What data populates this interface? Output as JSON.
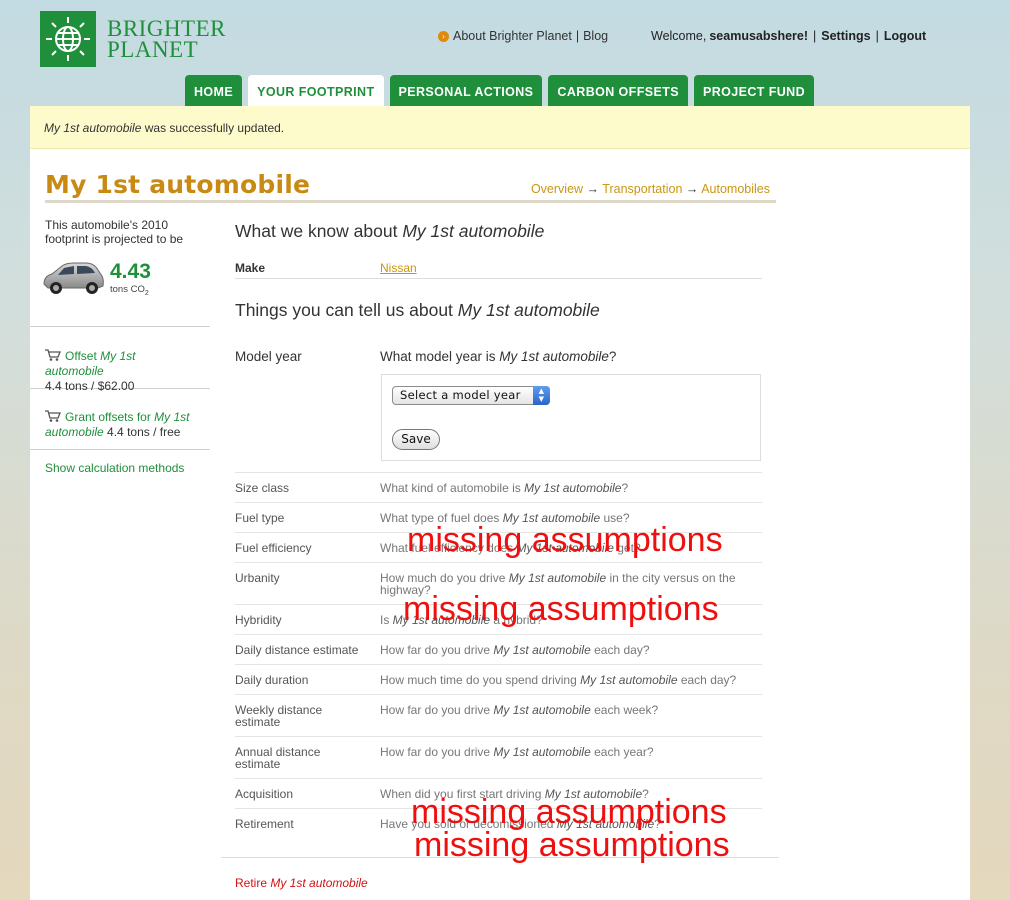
{
  "brand": {
    "line1": "BRIGHTER",
    "line2": "PLANET"
  },
  "topnav": {
    "about": "About Brighter Planet",
    "sep": "|",
    "blog": "Blog"
  },
  "userbar": {
    "welcome": "Welcome,",
    "username": "seamusabshere!",
    "sep": "|",
    "settings": "Settings",
    "logout": "Logout"
  },
  "tabs": [
    "HOME",
    "YOUR FOOTPRINT",
    "PERSONAL ACTIONS",
    "CARBON OFFSETS",
    "PROJECT FUND"
  ],
  "active_tab": "YOUR FOOTPRINT",
  "flash": {
    "name": "My 1st automobile",
    "text": " was successfully updated."
  },
  "page": {
    "title": "My 1st automobile"
  },
  "breadcrumb": {
    "overview": "Overview",
    "arrow": "→",
    "transportation": "Transportation",
    "automobiles": "Automobiles"
  },
  "sidebar": {
    "projection_text": "This automobile's 2010 footprint is projected to be",
    "value": "4.43",
    "unit": "tons CO",
    "unit_sub": "2",
    "offset_prefix": "Offset ",
    "offset_name": "My 1st automobile",
    "offset_detail": "4.4 tons / $62.00",
    "grant_prefix": "Grant offsets for ",
    "grant_name": "My 1st automobile",
    "grant_detail": " 4.4 tons / free",
    "calc_link": "Show calculation methods"
  },
  "known": {
    "heading_prefix": "What we know about ",
    "heading_name": "My 1st automobile",
    "make_label": "Make",
    "make_value": "Nissan"
  },
  "tell": {
    "heading_prefix": "Things you can tell us about ",
    "heading_name": "My 1st automobile"
  },
  "model_year": {
    "label": "Model year",
    "question_prefix": "What model year is ",
    "question_name": "My 1st automobile",
    "question_suffix": "?",
    "select_value": "Select a model year",
    "save_label": "Save"
  },
  "questions": [
    {
      "label": "Size class",
      "pre": "What kind of automobile is ",
      "name": "My 1st automobile",
      "post": "?"
    },
    {
      "label": "Fuel type",
      "pre": "What type of fuel does ",
      "name": "My 1st automobile",
      "post": " use?"
    },
    {
      "label": "Fuel efficiency",
      "pre": "What fuel efficiency does ",
      "name": "My 1st automobile",
      "post": " get?"
    },
    {
      "label": "Urbanity",
      "pre": "How much do you drive ",
      "name": "My 1st automobile",
      "post": " in the city versus on the highway?"
    },
    {
      "label": "Hybridity",
      "pre": "Is ",
      "name": "My 1st automobile",
      "post": " a hybrid?"
    },
    {
      "label": "Daily distance estimate",
      "pre": "How far do you drive ",
      "name": "My 1st automobile",
      "post": " each day?"
    },
    {
      "label": "Daily duration",
      "pre": "How much time do you spend driving ",
      "name": "My 1st automobile",
      "post": " each day?"
    },
    {
      "label": "Weekly distance estimate",
      "pre": "How far do you drive ",
      "name": "My 1st automobile",
      "post": " each week?"
    },
    {
      "label": "Annual distance estimate",
      "pre": "How far do you drive ",
      "name": "My 1st automobile",
      "post": " each year?"
    },
    {
      "label": "Acquisition",
      "pre": "When did you first start driving ",
      "name": "My 1st automobile",
      "post": "?"
    },
    {
      "label": "Retirement",
      "pre": "Have you sold or decomissioned ",
      "name": "My 1st automobile",
      "post": "?"
    }
  ],
  "retire": {
    "prefix": "Retire ",
    "name": "My 1st automobile"
  },
  "annotations": [
    "missing assumptions",
    "missing assumptions",
    "missing assumptions",
    "missing assumptions"
  ],
  "colors": {
    "brand_green": "#1f8f3c",
    "title_orange": "#c88a12",
    "link_gold": "#c99712",
    "flash_bg": "#fdfbcb",
    "annotation_red": "#ee0f0f",
    "retire_red": "#d01313"
  }
}
